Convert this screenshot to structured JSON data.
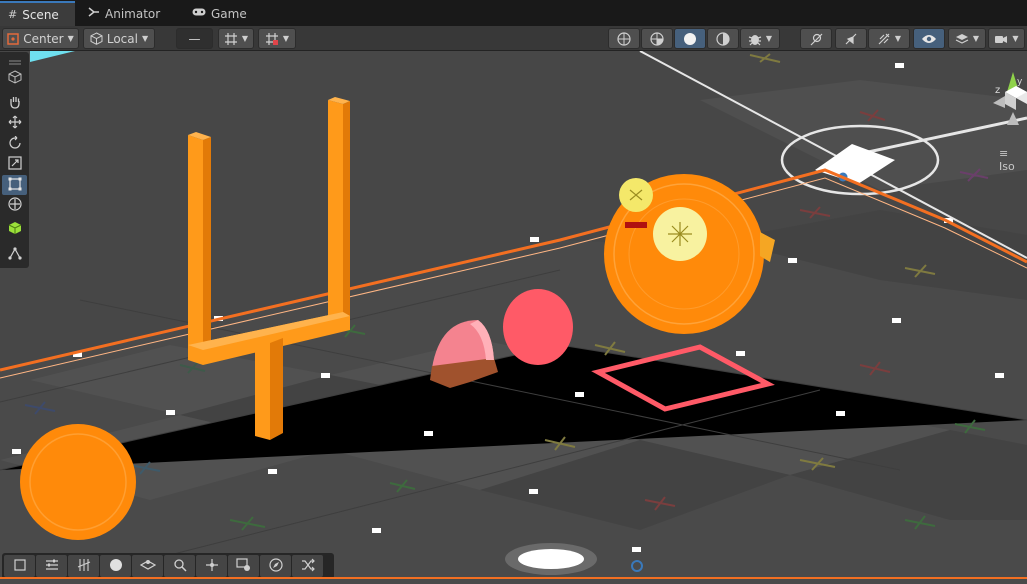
{
  "tabs": [
    {
      "label": "Scene",
      "icon": "hash-icon",
      "active": true
    },
    {
      "label": "Animator",
      "icon": "animator-icon",
      "active": false
    },
    {
      "label": "Game",
      "icon": "gamepad-icon",
      "active": false
    }
  ],
  "toolbar": {
    "pivot_label": "Center",
    "space_label": "Local",
    "snap_value": "—"
  },
  "gizmo": {
    "projection_label": "Iso"
  },
  "colors": {
    "accent": "#3a79bb",
    "selection_outline": "#f36f21",
    "goalpost": "#ff9a1a",
    "pink": "#f4838f",
    "red_shape": "#ff5a67"
  }
}
